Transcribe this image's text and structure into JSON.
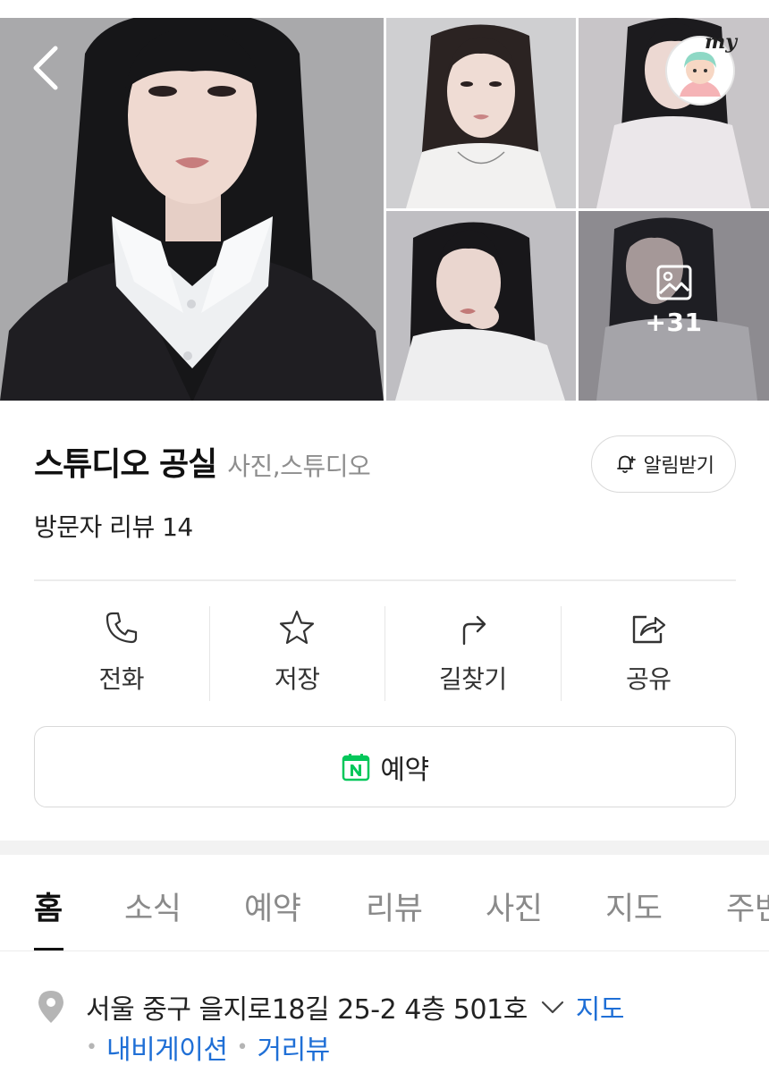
{
  "gallery": {
    "more_count": "+31"
  },
  "place": {
    "name": "스튜디오 공실",
    "category": "사진,스튜디오",
    "review_label": "방문자 리뷰 14",
    "notify_label": "알림받기"
  },
  "profile": {
    "my_label": "my"
  },
  "actions": [
    {
      "label": "전화",
      "icon": "phone-icon"
    },
    {
      "label": "저장",
      "icon": "star-icon"
    },
    {
      "label": "길찾기",
      "icon": "directions-icon"
    },
    {
      "label": "공유",
      "icon": "share-icon"
    }
  ],
  "reserve": {
    "label": "예약",
    "icon": "naver-booking-icon",
    "icon_color": "#03c75a"
  },
  "tabs": [
    {
      "label": "홈",
      "active": true
    },
    {
      "label": "소식",
      "active": false
    },
    {
      "label": "예약",
      "active": false
    },
    {
      "label": "리뷰",
      "active": false
    },
    {
      "label": "사진",
      "active": false
    },
    {
      "label": "지도",
      "active": false
    },
    {
      "label": "주변",
      "active": false
    }
  ],
  "address": {
    "text": "서울 중구 을지로18길 25-2 4층 501호",
    "map_link": "지도",
    "sub_links": [
      "내비게이션",
      "거리뷰"
    ]
  },
  "colors": {
    "link": "#1f6fd6",
    "muted": "#8e8e8e"
  }
}
